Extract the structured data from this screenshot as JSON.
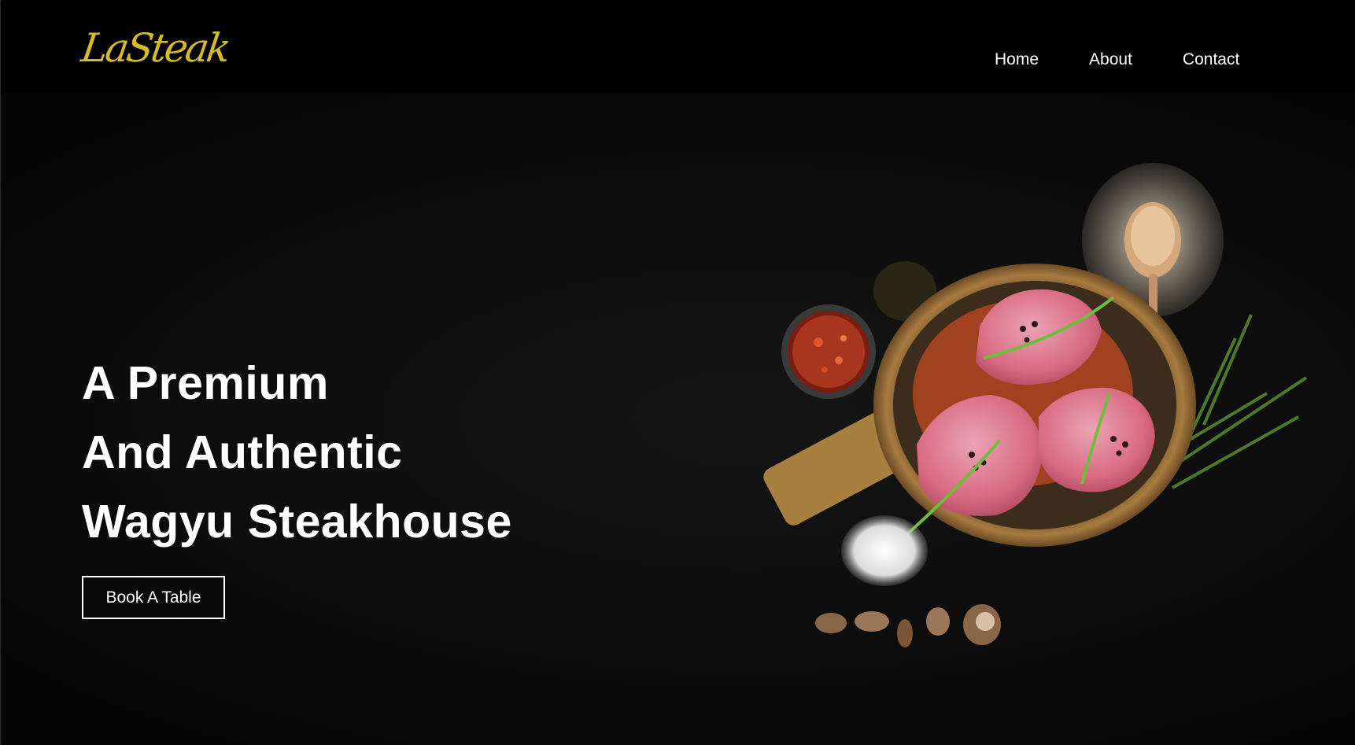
{
  "brand": {
    "logo": "LaSteak",
    "logo_color": "#d4bb2a"
  },
  "nav": {
    "items": [
      {
        "label": "Home"
      },
      {
        "label": "About"
      },
      {
        "label": "Contact"
      }
    ]
  },
  "hero": {
    "headline_lines": [
      "A Premium",
      "And Authentic",
      "Wagyu Steakhouse"
    ],
    "cta_label": "Book A Table"
  },
  "colors": {
    "background": "#000000",
    "text": "#ffffff",
    "meat": "#d96a82"
  },
  "icons": {
    "hero_image": "steak-board-illustration"
  }
}
